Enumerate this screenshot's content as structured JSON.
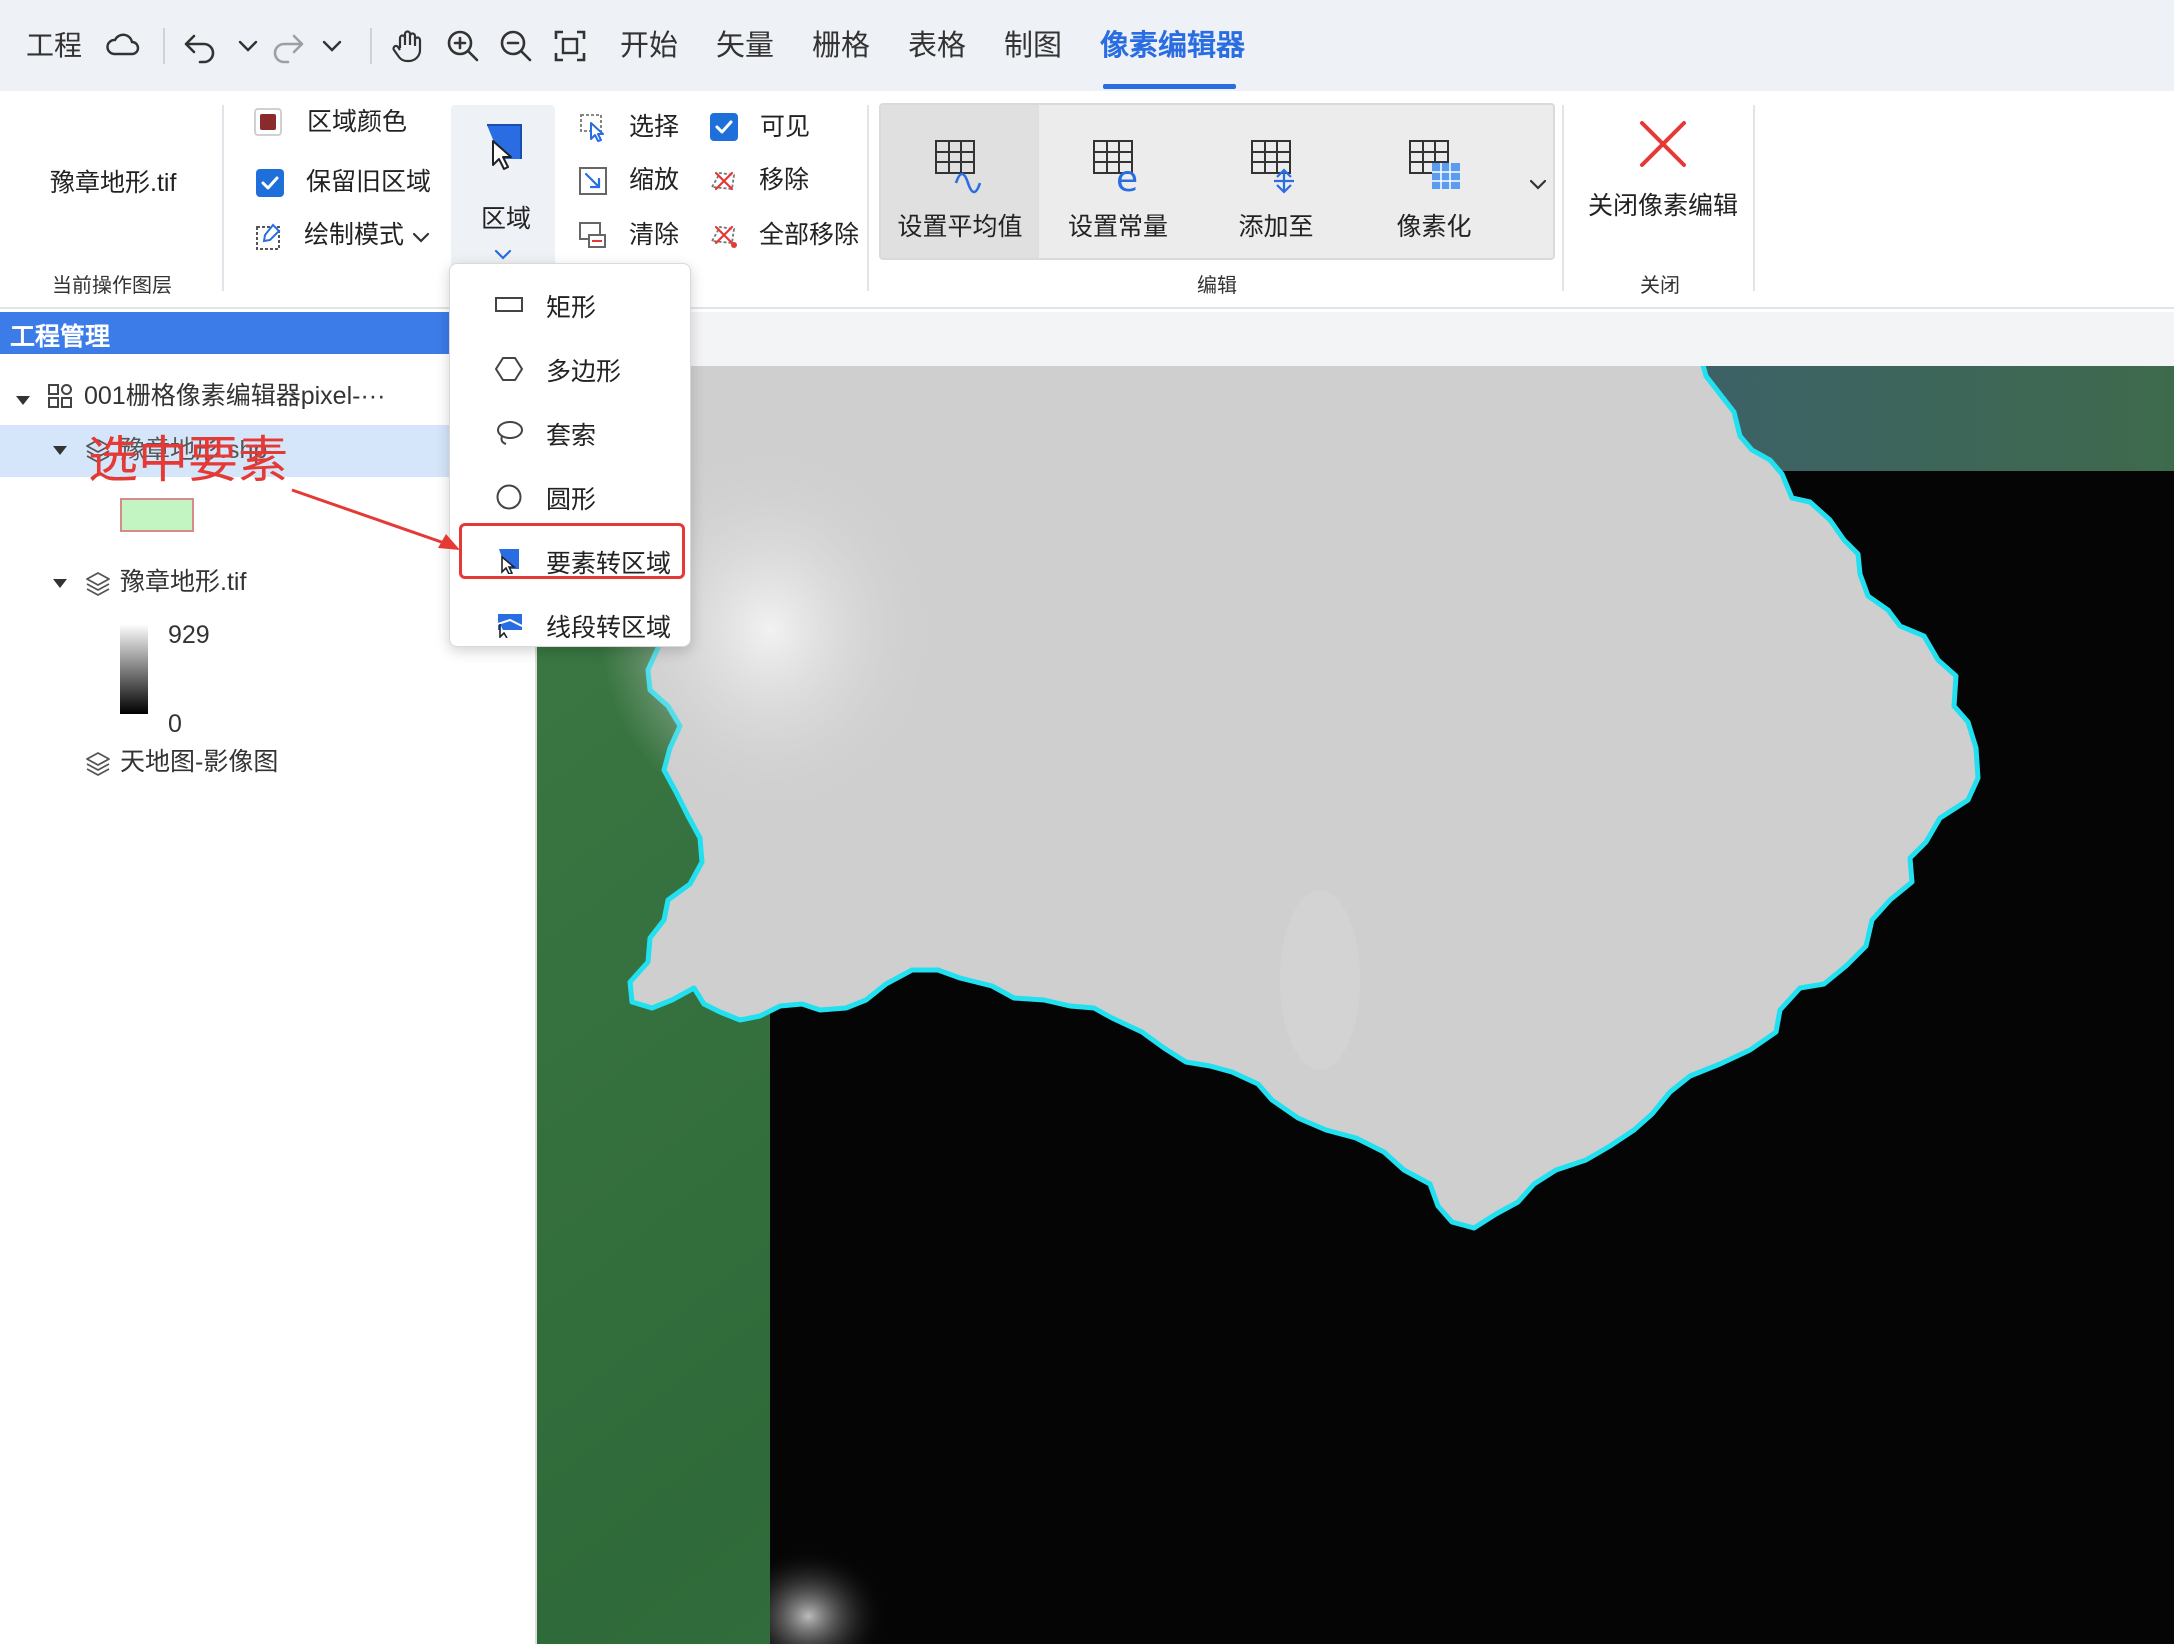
{
  "topbar": {
    "project_label": "工程",
    "tabs": [
      "开始",
      "矢量",
      "栅格",
      "表格",
      "制图",
      "像素编辑器"
    ],
    "active_tab": "像素编辑器",
    "accent_color": "#2a6de3"
  },
  "ribbon": {
    "current_layer": {
      "file": "豫章地形.tif",
      "group_label": "当前操作图层"
    },
    "region_options": {
      "region_color_label": "区域颜色",
      "region_color": "#8b2a2a",
      "keep_old_region_label": "保留旧区域",
      "keep_old_region_checked": true,
      "draw_mode_label": "绘制模式"
    },
    "region_button_label": "区域",
    "select_tools": {
      "select_label": "选择",
      "zoom_label": "缩放",
      "clear_label": "清除",
      "visible_label": "可见",
      "visible_checked": true,
      "remove_label": "移除",
      "remove_all_label": "全部移除"
    },
    "edit_group": {
      "buttons": [
        "设置平均值",
        "设置常量",
        "添加至",
        "像素化"
      ],
      "group_label": "编辑"
    },
    "close_group": {
      "button_label": "关闭像素编辑",
      "group_label": "关闭"
    }
  },
  "left_panel": {
    "title": "工程管理",
    "tree": {
      "project_name": "001栅格像素编辑器pixel-···",
      "selected_layer_partial": "豫章地形.shp",
      "dem_layer": "豫章地形.tif",
      "legend_max": "929",
      "legend_min": "0",
      "basemap_layer": "天地图-影像图"
    },
    "annotation_text": "选中要素",
    "annotation_color": "#e53935"
  },
  "dropdown": {
    "items": [
      "矩形",
      "多边形",
      "套索",
      "圆形",
      "要素转区域",
      "线段转区域"
    ],
    "highlighted": "要素转区域"
  }
}
